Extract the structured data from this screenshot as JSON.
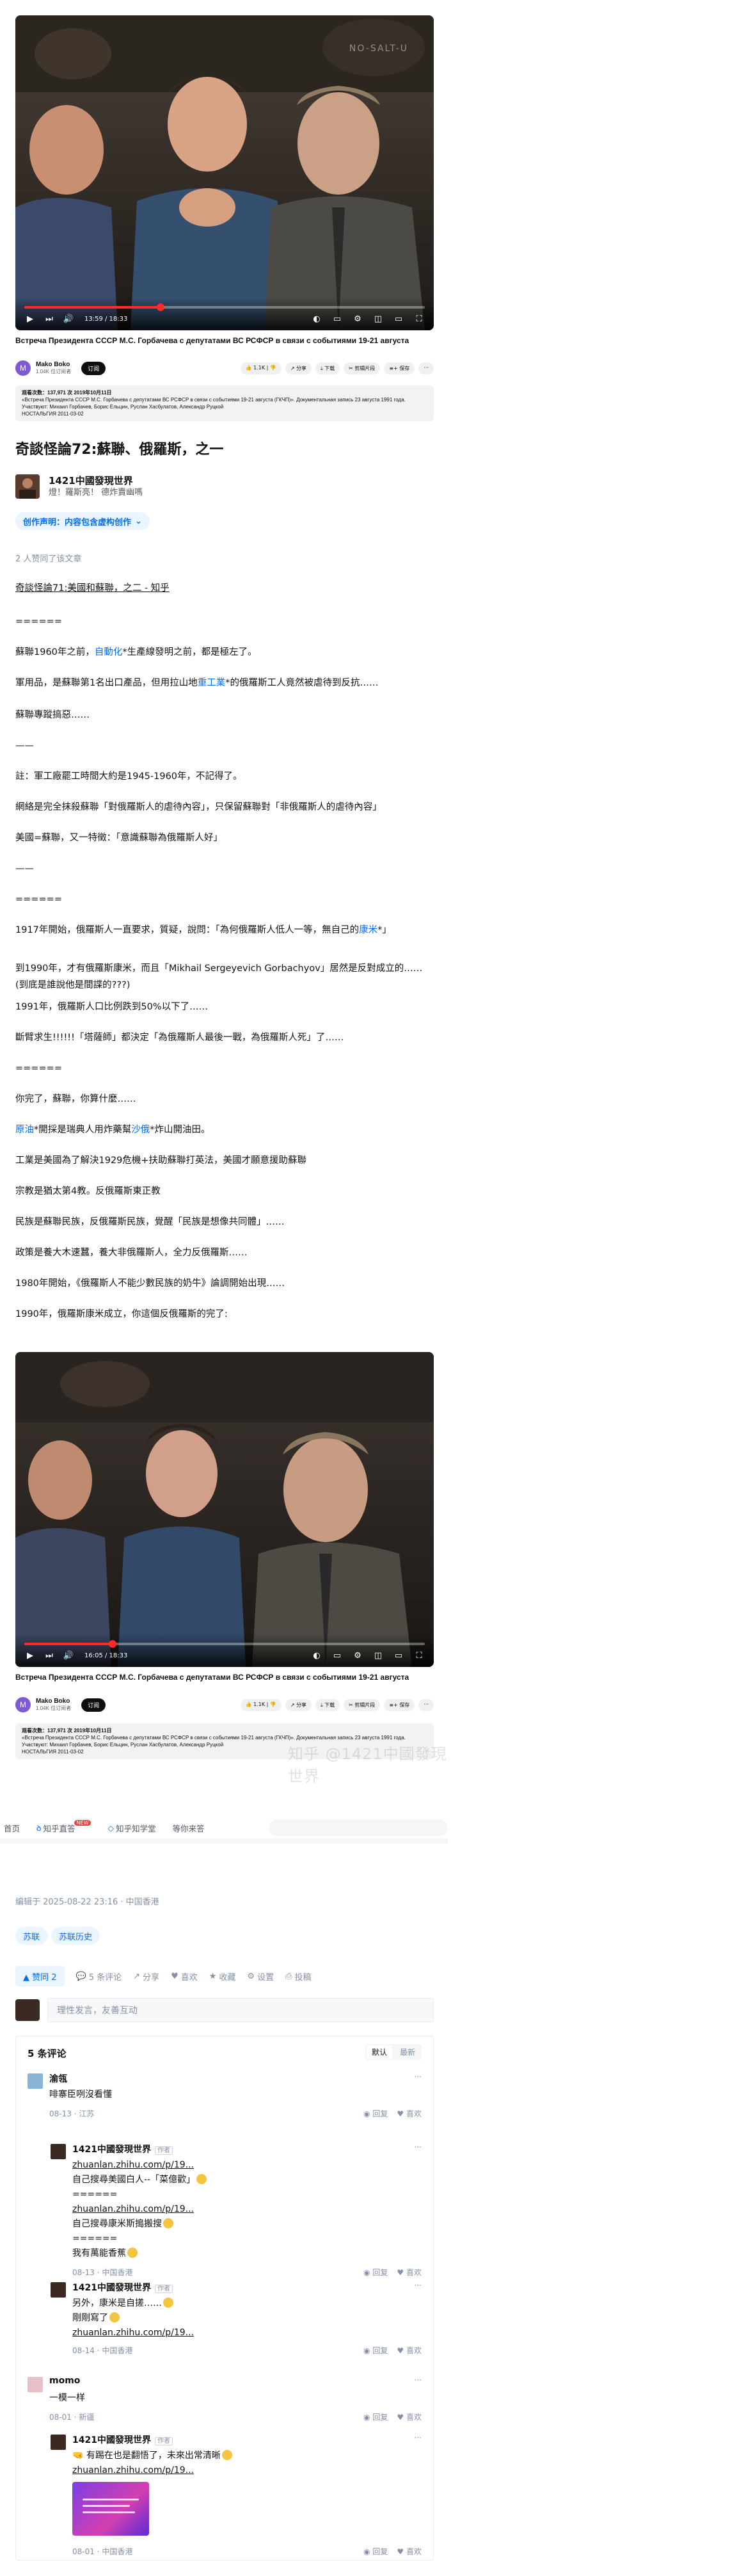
{
  "video1": {
    "watermark": "NO-SALT-U",
    "time": "13:59 / 18:33",
    "progress": 0.34,
    "title": "Встреча Президента СССР М.С. Горбачева с депутатами ВС РСФСР в связи с событиями 19-21 августа",
    "channel": "Mako Boko",
    "subscribers": "1.04K 位订阅者",
    "subscribe": "订阅",
    "likes": "1.1K",
    "share": "分享",
    "download": "下载",
    "clip": "剪辑片段",
    "save": "保存",
    "desc_stats": "观看次数：137,971 次  2019年10月11日",
    "desc_1": "«Встреча Президента СССР М.С. Горбачева с депутатами ВС РСФСР в связи с событиями 19-21 августа (ГКЧП)». Документальная запись 23 августа 1991 года.",
    "desc_2": "Участвуют: Михаил Горбачев, Борис Ельцин, Руслан Хасбулатов, Александр Руцкой",
    "desc_3": "НОСТАЛЬГИЯ 2011-03-02"
  },
  "article": {
    "title": "奇談怪論72:蘇聯、俄羅斯，之一",
    "author": "1421中國發現世界",
    "bio": "燈！羅斯亮！ 德炸賣幽嗎",
    "declaration": "创作声明：内容包含虚构创作",
    "liked_by": "2 人赞同了该文章",
    "paragraphs": [
      {
        "text": "奇談怪論71:美國和蘇聯，之二 - 知乎",
        "u": true
      },
      {
        "text": "======"
      },
      {
        "pre": "蘇聯1960年之前，",
        "link": "自動化",
        "post": "*生產線發明之前，都是極左了。"
      },
      {
        "pre": "軍用品，是蘇聯第1名出口產品，但用拉山地",
        "link": "重工業",
        "post": "*的俄羅斯工人竟然被虐待到反抗……"
      },
      {
        "text": "蘇聯專蹤搞惡……"
      },
      {
        "text": "——"
      },
      {
        "text": "註：軍工廠罷工時間大約是1945-1960年，不記得了。"
      },
      {
        "text": "網絡是完全抹殺蘇聯「對俄羅斯人的虐待內容」，只保留蘇聯對「非俄羅斯人的虐待內容」"
      },
      {
        "text": "美國=蘇聯，又一特徵：「意識蘇聯為俄羅斯人好」"
      },
      {
        "text": "——"
      },
      {
        "text": "======"
      },
      {
        "pre": "1917年開始，俄羅斯人一直要求，質疑，說問：「為何俄羅斯人低人一等，無自己的",
        "link": "康米",
        "post": "*」"
      },
      {
        "text": "到1990年，才有俄羅斯康米，而且「Mikhail Sergeyevich Gorbachyov」居然是反對成立的……(到底是誰說他是間諜的???)"
      },
      {
        "text": "1991年，俄羅斯人口比例跌到50%以下了……"
      },
      {
        "text": "斷臂求生!!!!!!「塔薩師」都決定「為俄羅斯人最後一戰，為俄羅斯人死」了……"
      },
      {
        "text": "======"
      },
      {
        "text": "你完了，蘇聯，你算什麼……"
      },
      {
        "pre": "",
        "link": "原油",
        "post": "*開採是瑞典人用炸藥幫",
        "link2": "沙俄",
        "post2": "*炸山開油田。"
      },
      {
        "text": "工業是美國為了解決1929危機+扶助蘇聯打英法，美國才願意援助蘇聯"
      },
      {
        "text": "宗教是猶太第4教。反俄羅斯東正教"
      },
      {
        "text": "民族是蘇聯民族，反俄羅斯民族，覺醒「民族是想像共同體」……"
      },
      {
        "text": "政策是養大木速蠶，養大非俄羅斯人，全力反俄羅斯……"
      },
      {
        "text": "1980年開始，《俄羅斯人不能少數民族的奶牛》論調開始出現……"
      },
      {
        "text": "1990年，俄羅斯康米成立，你這個反俄羅斯的完了:"
      }
    ]
  },
  "video2": {
    "watermark": "",
    "time": "16:05 / 18:33",
    "progress": 0.22,
    "title": "Встреча Президента СССР М.С. Горбачева с депутатами ВС РСФСР в связи с событиями 19-21 августа",
    "channel": "Mako Boko",
    "subscribers": "1.04K 位订阅者",
    "subscribe": "订阅",
    "likes": "1.1K",
    "share": "分享",
    "download": "下载",
    "clip": "剪辑片段",
    "save": "保存",
    "desc_stats": "观看次数：137,971 次  2019年10月11日",
    "desc_1": "«Встреча Президента СССР М.С. Горбачева с депутатами ВС РСФСР в связи с событиями 19-21 августа (ГКЧП)». Документальная запись 23 августа 1991 года.",
    "desc_2": "Участвуют: Михаил Горбачев, Борис Ельцин, Руслан Хасбулатов, Александр Руцкой",
    "desc_3": "НОСТАЛЬГИЯ 2011-03-02"
  },
  "watermark_text": "知乎 @1421中國發現世界",
  "tabs": {
    "home": "首页",
    "zhida": "知乎直答",
    "zhixue": "知乎知学堂",
    "waiting": "等你来答",
    "new_badge": "NEW"
  },
  "footer": {
    "edited": "编辑于 2025-08-22 23:16 · 中国香港",
    "tags": [
      "苏联",
      "苏联历史"
    ],
    "vote": "▲ 赞同 2",
    "comments": "5 条评论",
    "share": "分享",
    "like": "喜欢",
    "fav": "收藏",
    "settings": "设置",
    "report": "投稿",
    "reply_placeholder": "理性发言，友善互动"
  },
  "comment_section": {
    "header": "5 条评论",
    "sort_default": "默认",
    "sort_latest": "最新",
    "reply": "回复",
    "like": "喜欢",
    "author_tag": "作者",
    "items": [
      {
        "name": "渝瓴",
        "text": "啡寨臣咧沒看懂",
        "meta": "08-13 · 江苏"
      },
      {
        "name": "1421中國發現世界",
        "lines": [
          "zhuanlan.zhihu.com/p/19...",
          "自己搜尋美國白人--「菜億歡」",
          "======",
          "zhuanlan.zhihu.com/p/19...",
          "自己搜尋康米斯搗搬搜",
          "======",
          "我有萬能香蕉"
        ],
        "meta": "08-13 · 中国香港"
      },
      {
        "name": "1421中國發現世界",
        "lines": [
          "另外，康米是自搓……",
          "剛剛寫了",
          "zhuanlan.zhihu.com/p/19..."
        ],
        "meta": "08-14 · 中国香港"
      },
      {
        "name": "momo",
        "text": "一模一样",
        "meta": "08-01 · 新疆"
      },
      {
        "name": "1421中國發現世界",
        "lines": [
          "🤜 有踢在也是翻悟了，未來出常清晰",
          "zhuanlan.zhihu.com/p/19..."
        ],
        "meta": "08-01 · 中国香港"
      }
    ]
  }
}
